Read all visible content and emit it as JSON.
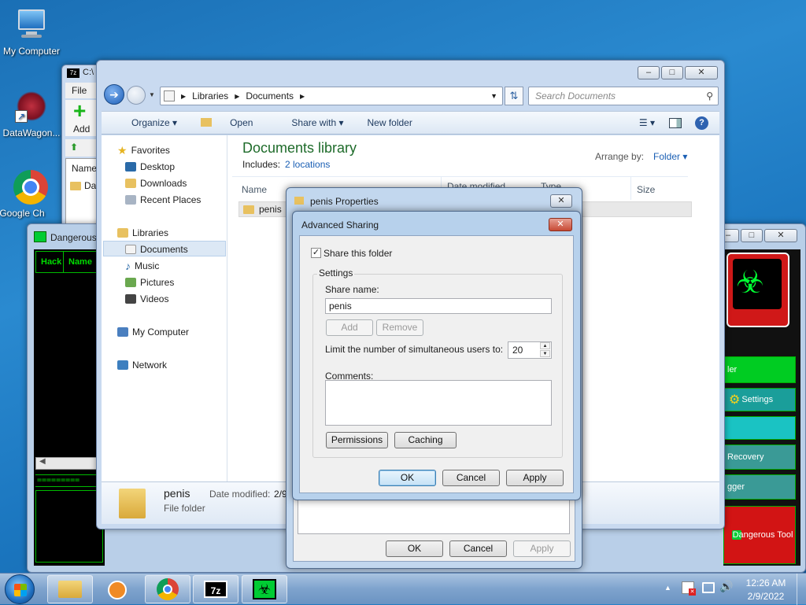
{
  "desktop": {
    "icons": [
      {
        "label": "My Computer"
      },
      {
        "label": "DataWagon..."
      },
      {
        "label": "Google Ch"
      }
    ]
  },
  "sevenzip": {
    "title": "C:\\",
    "menu_file": "File",
    "add_label": "Add",
    "col_name": "Name",
    "row1": "Da"
  },
  "explorer": {
    "breadcrumb": [
      "Libraries",
      "Documents"
    ],
    "search_placeholder": "Search Documents",
    "toolbar": {
      "organize": "Organize",
      "open": "Open",
      "share_with": "Share with",
      "new_folder": "New folder"
    },
    "nav": {
      "favorites": "Favorites",
      "desktop": "Desktop",
      "downloads": "Downloads",
      "recent": "Recent Places",
      "libraries": "Libraries",
      "documents": "Documents",
      "music": "Music",
      "pictures": "Pictures",
      "videos": "Videos",
      "computer": "My Computer",
      "network": "Network"
    },
    "library_title": "Documents library",
    "includes_label": "Includes:",
    "includes_link": "2 locations",
    "arrange_label": "Arrange by:",
    "arrange_value": "Folder",
    "columns": {
      "name": "Name",
      "date": "Date modified",
      "type": "Type",
      "size": "Size"
    },
    "file_name": "penis",
    "details": {
      "name": "penis",
      "date_label": "Date modified:",
      "date_value": "2/9",
      "type": "File folder"
    }
  },
  "properties": {
    "title": "penis Properties",
    "ok": "OK",
    "cancel": "Cancel",
    "apply": "Apply"
  },
  "advanced_sharing": {
    "title": "Advanced Sharing",
    "share_checkbox": "Share this folder",
    "settings_label": "Settings",
    "share_name_label": "Share name:",
    "share_name_value": "penis",
    "add": "Add",
    "remove": "Remove",
    "limit_label": "Limit the number of simultaneous users to:",
    "limit_value": "20",
    "comments_label": "Comments:",
    "permissions": "Permissions",
    "caching": "Caching",
    "ok": "OK",
    "cancel": "Cancel",
    "apply": "Apply"
  },
  "dangerous_tool": {
    "title": "Dangerous",
    "col_hack": "Hack",
    "col_name": "Name",
    "divider": "=========",
    "buttons": {
      "ler": "ler",
      "settings": "Settings",
      "recovery": "Recovery",
      "gger": "gger",
      "tool": "Dangerous Tool"
    }
  },
  "taskbar": {
    "time": "12:26 AM",
    "date": "2/9/2022"
  }
}
